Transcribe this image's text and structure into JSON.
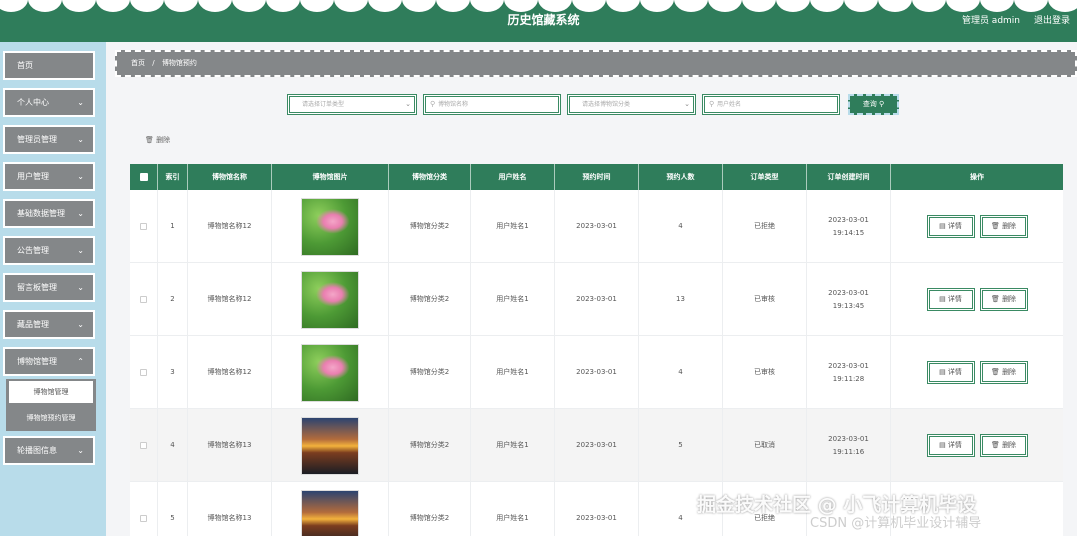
{
  "header": {
    "title": "历史馆藏系统",
    "user": "管理员 admin",
    "logout": "退出登录",
    "color": "#2f7d5b"
  },
  "sidebar": {
    "items": [
      {
        "label": "首页",
        "has_chevron": false
      },
      {
        "label": "个人中心",
        "has_chevron": true
      },
      {
        "label": "管理员管理",
        "has_chevron": true
      },
      {
        "label": "用户管理",
        "has_chevron": true
      },
      {
        "label": "基础数据管理",
        "has_chevron": true
      },
      {
        "label": "公告管理",
        "has_chevron": true
      },
      {
        "label": "留言板管理",
        "has_chevron": true
      },
      {
        "label": "藏品管理",
        "has_chevron": true
      },
      {
        "label": "博物馆管理",
        "has_chevron": true
      },
      {
        "label": "轮播图信息",
        "has_chevron": true
      }
    ],
    "submenu": [
      "博物馆管理",
      "博物馆预约管理"
    ]
  },
  "breadcrumb": {
    "home": "首页",
    "sep": "/",
    "current": "博物馆预约"
  },
  "filters": {
    "order_type_placeholder": "请选择订单类型",
    "museum_name_placeholder": "博物馆名称",
    "museum_category_placeholder": "请选择博物馆分类",
    "user_name_placeholder": "用户姓名",
    "query_label": "查询"
  },
  "delete_label": "删除",
  "table": {
    "headers": [
      "",
      "索引",
      "博物馆名称",
      "博物馆图片",
      "博物馆分类",
      "用户姓名",
      "预约时间",
      "预约人数",
      "订单类型",
      "订单创建时间",
      "操作"
    ],
    "rows": [
      {
        "index": "1",
        "name": "博物馆名称12",
        "image": "lotus-image",
        "category": "博物馆分类2",
        "user": "用户姓名1",
        "date": "2023-03-01",
        "count": "4",
        "status": "已拒绝",
        "created": "2023-03-01 19:14:15"
      },
      {
        "index": "2",
        "name": "博物馆名称12",
        "image": "lotus-image",
        "category": "博物馆分类2",
        "user": "用户姓名1",
        "date": "2023-03-01",
        "count": "13",
        "status": "已审核",
        "created": "2023-03-01 19:13:45"
      },
      {
        "index": "3",
        "name": "博物馆名称12",
        "image": "lotus-image",
        "category": "博物馆分类2",
        "user": "用户姓名1",
        "date": "2023-03-01",
        "count": "4",
        "status": "已审核",
        "created": "2023-03-01 19:11:28"
      },
      {
        "index": "4",
        "name": "博物馆名称13",
        "image": "sunset-road-image",
        "category": "博物馆分类2",
        "user": "用户姓名1",
        "date": "2023-03-01",
        "count": "5",
        "status": "已取消",
        "created": "2023-03-01 19:11:16"
      },
      {
        "index": "5",
        "name": "博物馆名称13",
        "image": "sunset-road-image",
        "category": "博物馆分类2",
        "user": "用户姓名1",
        "date": "2023-03-01",
        "count": "4",
        "status": "已拒绝",
        "created": ""
      }
    ],
    "detail_label": "详情",
    "delete_label": "删除"
  },
  "watermark": {
    "text": "掘金技术社区 @ 小飞计算机毕设",
    "sub": "CSDN @计算机毕业设计辅导"
  }
}
